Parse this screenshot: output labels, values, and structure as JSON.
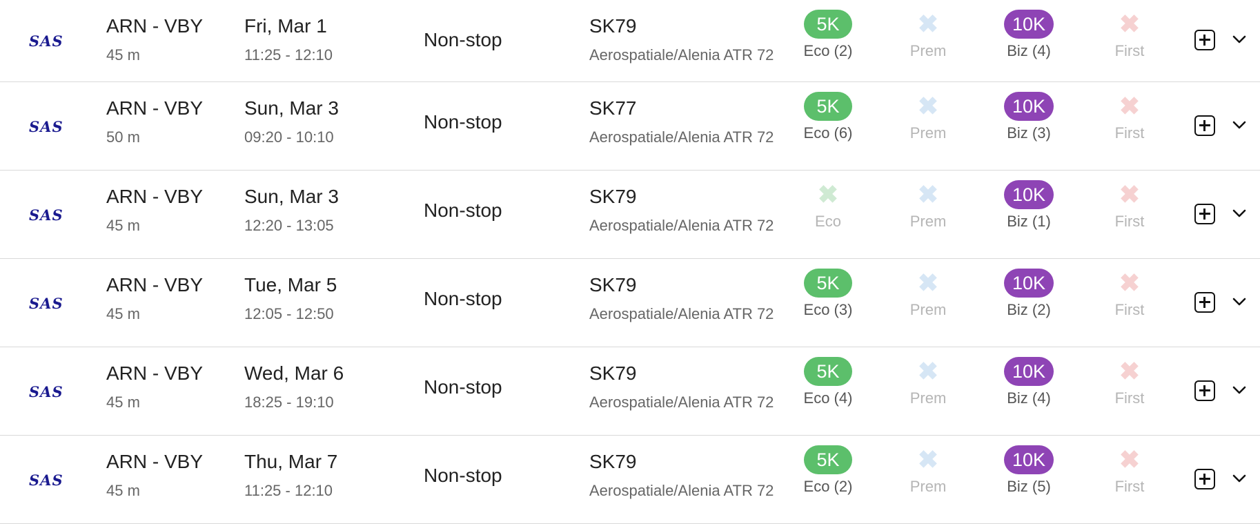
{
  "flights": [
    {
      "airline": "SAS",
      "route": "ARN - VBY",
      "duration": "45 m",
      "date": "Fri, Mar 1",
      "times": "11:25 - 12:10",
      "stops": "Non-stop",
      "flight_no": "SK79",
      "aircraft": "Aerospatiale/Alenia ATR 72",
      "cabins": {
        "eco": {
          "available": true,
          "price": "5K",
          "label": "Eco (2)"
        },
        "prem": {
          "available": false,
          "label": "Prem"
        },
        "biz": {
          "available": true,
          "price": "10K",
          "label": "Biz (4)"
        },
        "first": {
          "available": false,
          "label": "First"
        }
      }
    },
    {
      "airline": "SAS",
      "route": "ARN - VBY",
      "duration": "50 m",
      "date": "Sun, Mar 3",
      "times": "09:20 - 10:10",
      "stops": "Non-stop",
      "flight_no": "SK77",
      "aircraft": "Aerospatiale/Alenia ATR 72",
      "cabins": {
        "eco": {
          "available": true,
          "price": "5K",
          "label": "Eco (6)"
        },
        "prem": {
          "available": false,
          "label": "Prem"
        },
        "biz": {
          "available": true,
          "price": "10K",
          "label": "Biz (3)"
        },
        "first": {
          "available": false,
          "label": "First"
        }
      }
    },
    {
      "airline": "SAS",
      "route": "ARN - VBY",
      "duration": "45 m",
      "date": "Sun, Mar 3",
      "times": "12:20 - 13:05",
      "stops": "Non-stop",
      "flight_no": "SK79",
      "aircraft": "Aerospatiale/Alenia ATR 72",
      "cabins": {
        "eco": {
          "available": false,
          "label": "Eco"
        },
        "prem": {
          "available": false,
          "label": "Prem"
        },
        "biz": {
          "available": true,
          "price": "10K",
          "label": "Biz (1)"
        },
        "first": {
          "available": false,
          "label": "First"
        }
      }
    },
    {
      "airline": "SAS",
      "route": "ARN - VBY",
      "duration": "45 m",
      "date": "Tue, Mar 5",
      "times": "12:05 - 12:50",
      "stops": "Non-stop",
      "flight_no": "SK79",
      "aircraft": "Aerospatiale/Alenia ATR 72",
      "cabins": {
        "eco": {
          "available": true,
          "price": "5K",
          "label": "Eco (3)"
        },
        "prem": {
          "available": false,
          "label": "Prem"
        },
        "biz": {
          "available": true,
          "price": "10K",
          "label": "Biz (2)"
        },
        "first": {
          "available": false,
          "label": "First"
        }
      }
    },
    {
      "airline": "SAS",
      "route": "ARN - VBY",
      "duration": "45 m",
      "date": "Wed, Mar 6",
      "times": "18:25 - 19:10",
      "stops": "Non-stop",
      "flight_no": "SK79",
      "aircraft": "Aerospatiale/Alenia ATR 72",
      "cabins": {
        "eco": {
          "available": true,
          "price": "5K",
          "label": "Eco (4)"
        },
        "prem": {
          "available": false,
          "label": "Prem"
        },
        "biz": {
          "available": true,
          "price": "10K",
          "label": "Biz (4)"
        },
        "first": {
          "available": false,
          "label": "First"
        }
      }
    },
    {
      "airline": "SAS",
      "route": "ARN - VBY",
      "duration": "45 m",
      "date": "Thu, Mar 7",
      "times": "11:25 - 12:10",
      "stops": "Non-stop",
      "flight_no": "SK79",
      "aircraft": "Aerospatiale/Alenia ATR 72",
      "cabins": {
        "eco": {
          "available": true,
          "price": "5K",
          "label": "Eco (2)"
        },
        "prem": {
          "available": false,
          "label": "Prem"
        },
        "biz": {
          "available": true,
          "price": "10K",
          "label": "Biz (5)"
        },
        "first": {
          "available": false,
          "label": "First"
        }
      }
    }
  ],
  "unavailable_glyph": "✖",
  "colors": {
    "eco": "#5cbf6b",
    "biz": "#8e44b5",
    "airline_logo": "#1a1a8f"
  },
  "icons": {
    "add": "plus-square-icon",
    "expand": "chevron-down-icon"
  }
}
